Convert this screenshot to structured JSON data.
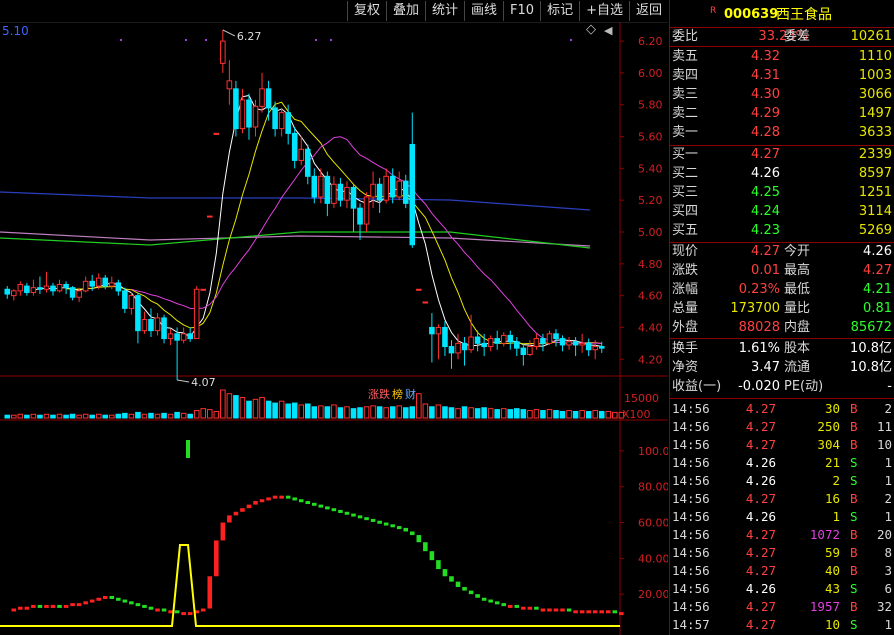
{
  "toolbar": {
    "buttons": [
      "复权",
      "叠加",
      "统计",
      "画线",
      "F10",
      "标记",
      "+自选",
      "返回"
    ]
  },
  "chart": {
    "ma_label": "5.10",
    "high_label": "6.27",
    "low_label": "4.07",
    "price_ticks": [
      "6.20",
      "6.00",
      "5.80",
      "5.60",
      "5.40",
      "5.20",
      "5.00",
      "4.80",
      "4.60",
      "4.40",
      "4.20"
    ],
    "volume_tick": "15000",
    "volume_unit": "X100",
    "ind_ticks": [
      "100.0",
      "80.00",
      "60.00",
      "40.00",
      "20.00"
    ],
    "badges": [
      {
        "text": "涨跌",
        "color": "#ff6060"
      },
      {
        "text": "榜",
        "color": "#ffcc00"
      },
      {
        "text": "财",
        "color": "#66aaff"
      }
    ],
    "diamond": "◇",
    "corner": "◀",
    "colors": {
      "up": "#ff3030",
      "down": "#00e5ff",
      "ma5": "#ffffff",
      "ma10": "#e6e600",
      "ma20": "#e040e0",
      "ma60": "#22cc22",
      "ma120": "#c080c0",
      "ma250": "#2a3fc0",
      "axis": "#8b0000"
    }
  },
  "stock": {
    "badge": "R",
    "code": "000639",
    "name": "西王食品"
  },
  "order_book": {
    "ratio_label": "委比",
    "ratio_value": "33.23%",
    "diff_label": "委差",
    "diff_value": "10261",
    "asks": [
      {
        "label": "卖五",
        "price": "4.32",
        "vol": "1110"
      },
      {
        "label": "卖四",
        "price": "4.31",
        "vol": "1003"
      },
      {
        "label": "卖三",
        "price": "4.30",
        "vol": "3066"
      },
      {
        "label": "卖二",
        "price": "4.29",
        "vol": "1497"
      },
      {
        "label": "卖一",
        "price": "4.28",
        "vol": "3633"
      }
    ],
    "bids": [
      {
        "label": "买一",
        "price": "4.27",
        "vol": "2339",
        "color": "red"
      },
      {
        "label": "买二",
        "price": "4.26",
        "vol": "8597",
        "color": "white"
      },
      {
        "label": "买三",
        "price": "4.25",
        "vol": "1251",
        "color": "green"
      },
      {
        "label": "买四",
        "price": "4.24",
        "vol": "3114",
        "color": "green"
      },
      {
        "label": "买五",
        "price": "4.23",
        "vol": "5269",
        "color": "green"
      }
    ]
  },
  "quote": [
    {
      "l1": "现价",
      "v1": "4.27",
      "c1": "red",
      "l2": "今开",
      "v2": "4.26",
      "c2": "white"
    },
    {
      "l1": "涨跌",
      "v1": "0.01",
      "c1": "red",
      "l2": "最高",
      "v2": "4.27",
      "c2": "red"
    },
    {
      "l1": "涨幅",
      "v1": "0.23%",
      "c1": "red",
      "l2": "最低",
      "v2": "4.21",
      "c2": "green"
    },
    {
      "l1": "总量",
      "v1": "173700",
      "c1": "yellow",
      "l2": "量比",
      "v2": "0.81",
      "c2": "green"
    },
    {
      "l1": "外盘",
      "v1": "88028",
      "c1": "red",
      "l2": "内盘",
      "v2": "85672",
      "c2": "green"
    }
  ],
  "fundamentals": [
    {
      "l1": "换手",
      "v1": "1.61%",
      "l2": "股本",
      "v2": "10.8亿"
    },
    {
      "l1": "净资",
      "v1": "3.47",
      "l2": "流通",
      "v2": "10.8亿"
    },
    {
      "l1": "收益(一)",
      "v1": "-0.020",
      "l2": "PE(动)",
      "v2": "-"
    }
  ],
  "trades": [
    {
      "time": "14:56",
      "price": "4.27",
      "pc": "red",
      "vol": "30",
      "vc": "yellow",
      "side": "B",
      "n": "2"
    },
    {
      "time": "14:56",
      "price": "4.27",
      "pc": "red",
      "vol": "250",
      "vc": "yellow",
      "side": "B",
      "n": "11"
    },
    {
      "time": "14:56",
      "price": "4.27",
      "pc": "red",
      "vol": "304",
      "vc": "yellow",
      "side": "B",
      "n": "10"
    },
    {
      "time": "14:56",
      "price": "4.26",
      "pc": "white",
      "vol": "21",
      "vc": "yellow",
      "side": "S",
      "n": "1"
    },
    {
      "time": "14:56",
      "price": "4.26",
      "pc": "white",
      "vol": "2",
      "vc": "yellow",
      "side": "S",
      "n": "1"
    },
    {
      "time": "14:56",
      "price": "4.27",
      "pc": "red",
      "vol": "16",
      "vc": "yellow",
      "side": "B",
      "n": "2"
    },
    {
      "time": "14:56",
      "price": "4.26",
      "pc": "white",
      "vol": "1",
      "vc": "yellow",
      "side": "S",
      "n": "1"
    },
    {
      "time": "14:56",
      "price": "4.27",
      "pc": "red",
      "vol": "1072",
      "vc": "magenta",
      "side": "B",
      "n": "20"
    },
    {
      "time": "14:56",
      "price": "4.27",
      "pc": "red",
      "vol": "59",
      "vc": "yellow",
      "side": "B",
      "n": "8"
    },
    {
      "time": "14:56",
      "price": "4.27",
      "pc": "red",
      "vol": "40",
      "vc": "yellow",
      "side": "B",
      "n": "3"
    },
    {
      "time": "14:56",
      "price": "4.26",
      "pc": "white",
      "vol": "43",
      "vc": "yellow",
      "side": "S",
      "n": "6"
    },
    {
      "time": "14:56",
      "price": "4.27",
      "pc": "red",
      "vol": "1957",
      "vc": "magenta",
      "side": "B",
      "n": "32"
    },
    {
      "time": "14:57",
      "price": "4.27",
      "pc": "red",
      "vol": "10",
      "vc": "yellow",
      "side": "S",
      "n": "1"
    }
  ],
  "chart_data": {
    "type": "candlestick",
    "price_axis": [
      4.2,
      6.2
    ],
    "candles": [
      {
        "o": 4.64,
        "c": 4.61,
        "h": 4.66,
        "l": 4.58
      },
      {
        "o": 4.6,
        "c": 4.63,
        "h": 4.64,
        "l": 4.57
      },
      {
        "o": 4.63,
        "c": 4.67,
        "h": 4.69,
        "l": 4.6
      },
      {
        "o": 4.66,
        "c": 4.62,
        "h": 4.68,
        "l": 4.6
      },
      {
        "o": 4.62,
        "c": 4.65,
        "h": 4.7,
        "l": 4.6
      },
      {
        "o": 4.65,
        "c": 4.64,
        "h": 4.72,
        "l": 4.61
      },
      {
        "o": 4.64,
        "c": 4.66,
        "h": 4.75,
        "l": 4.62
      },
      {
        "o": 4.66,
        "c": 4.63,
        "h": 4.68,
        "l": 4.6
      },
      {
        "o": 4.63,
        "c": 4.67,
        "h": 4.7,
        "l": 4.62
      },
      {
        "o": 4.67,
        "c": 4.65,
        "h": 4.69,
        "l": 4.61
      },
      {
        "o": 4.65,
        "c": 4.59,
        "h": 4.66,
        "l": 4.57
      },
      {
        "o": 4.59,
        "c": 4.63,
        "h": 4.65,
        "l": 4.56
      },
      {
        "o": 4.63,
        "c": 4.69,
        "h": 4.72,
        "l": 4.62
      },
      {
        "o": 4.69,
        "c": 4.66,
        "h": 4.73,
        "l": 4.63
      },
      {
        "o": 4.66,
        "c": 4.71,
        "h": 4.74,
        "l": 4.64
      },
      {
        "o": 4.71,
        "c": 4.66,
        "h": 4.73,
        "l": 4.64
      },
      {
        "o": 4.66,
        "c": 4.68,
        "h": 4.72,
        "l": 4.64
      },
      {
        "o": 4.68,
        "c": 4.63,
        "h": 4.7,
        "l": 4.6
      },
      {
        "o": 4.63,
        "c": 4.52,
        "h": 4.65,
        "l": 4.49
      },
      {
        "o": 4.52,
        "c": 4.6,
        "h": 4.62,
        "l": 4.48
      },
      {
        "o": 4.6,
        "c": 4.38,
        "h": 4.62,
        "l": 4.3
      },
      {
        "o": 4.38,
        "c": 4.45,
        "h": 4.5,
        "l": 4.36
      },
      {
        "o": 4.45,
        "c": 4.38,
        "h": 4.52,
        "l": 4.34
      },
      {
        "o": 4.38,
        "c": 4.46,
        "h": 4.49,
        "l": 4.35
      },
      {
        "o": 4.46,
        "c": 4.33,
        "h": 4.48,
        "l": 4.3
      },
      {
        "o": 4.33,
        "c": 4.36,
        "h": 4.39,
        "l": 4.29
      },
      {
        "o": 4.36,
        "c": 4.32,
        "h": 4.4,
        "l": 4.07
      },
      {
        "o": 4.32,
        "c": 4.36,
        "h": 4.4,
        "l": 4.3
      },
      {
        "o": 4.36,
        "c": 4.33,
        "h": 4.4,
        "l": 4.31
      },
      {
        "o": 4.33,
        "c": 4.64,
        "h": 4.66,
        "l": 4.33
      },
      {
        "o": 4.64,
        "c": 4.64,
        "h": 4.64,
        "l": 4.64
      },
      {
        "o": 5.1,
        "c": 5.1,
        "h": 5.1,
        "l": 5.1
      },
      {
        "o": 5.62,
        "c": 5.62,
        "h": 5.62,
        "l": 5.62
      },
      {
        "o": 6.06,
        "c": 6.2,
        "h": 6.27,
        "l": 6.0
      },
      {
        "o": 5.9,
        "c": 5.95,
        "h": 6.08,
        "l": 5.8
      },
      {
        "o": 5.9,
        "c": 5.65,
        "h": 5.95,
        "l": 5.6
      },
      {
        "o": 5.65,
        "c": 5.83,
        "h": 5.9,
        "l": 5.62
      },
      {
        "o": 5.83,
        "c": 5.66,
        "h": 5.87,
        "l": 5.58
      },
      {
        "o": 5.66,
        "c": 5.79,
        "h": 5.83,
        "l": 5.6
      },
      {
        "o": 5.79,
        "c": 5.9,
        "h": 6.0,
        "l": 5.75
      },
      {
        "o": 5.9,
        "c": 5.78,
        "h": 5.95,
        "l": 5.7
      },
      {
        "o": 5.78,
        "c": 5.65,
        "h": 5.82,
        "l": 5.6
      },
      {
        "o": 5.65,
        "c": 5.75,
        "h": 5.78,
        "l": 5.6
      },
      {
        "o": 5.75,
        "c": 5.62,
        "h": 5.8,
        "l": 5.55
      },
      {
        "o": 5.62,
        "c": 5.45,
        "h": 5.66,
        "l": 5.4
      },
      {
        "o": 5.45,
        "c": 5.52,
        "h": 5.6,
        "l": 5.42
      },
      {
        "o": 5.52,
        "c": 5.35,
        "h": 5.55,
        "l": 5.3
      },
      {
        "o": 5.35,
        "c": 5.22,
        "h": 5.4,
        "l": 5.18
      },
      {
        "o": 5.22,
        "c": 5.35,
        "h": 5.4,
        "l": 5.18
      },
      {
        "o": 5.35,
        "c": 5.18,
        "h": 5.38,
        "l": 5.1
      },
      {
        "o": 5.18,
        "c": 5.3,
        "h": 5.35,
        "l": 5.15
      },
      {
        "o": 5.3,
        "c": 5.2,
        "h": 5.34,
        "l": 5.16
      },
      {
        "o": 5.2,
        "c": 5.28,
        "h": 5.32,
        "l": 5.15
      },
      {
        "o": 5.28,
        "c": 5.15,
        "h": 5.3,
        "l": 5.0
      },
      {
        "o": 5.15,
        "c": 5.05,
        "h": 5.18,
        "l": 4.95
      },
      {
        "o": 5.05,
        "c": 5.22,
        "h": 5.25,
        "l": 5.0
      },
      {
        "o": 5.22,
        "c": 5.3,
        "h": 5.38,
        "l": 5.15
      },
      {
        "o": 5.3,
        "c": 5.2,
        "h": 5.34,
        "l": 5.12
      },
      {
        "o": 5.2,
        "c": 5.35,
        "h": 5.4,
        "l": 5.18
      },
      {
        "o": 5.35,
        "c": 5.22,
        "h": 5.4,
        "l": 5.18
      },
      {
        "o": 5.22,
        "c": 5.32,
        "h": 5.38,
        "l": 5.2
      },
      {
        "o": 5.32,
        "c": 5.18,
        "h": 5.36,
        "l": 5.15
      },
      {
        "o": 5.55,
        "c": 4.92,
        "h": 5.75,
        "l": 4.9
      },
      {
        "o": 4.64,
        "c": 4.64,
        "h": 4.64,
        "l": 4.64
      },
      {
        "o": 4.56,
        "c": 4.56,
        "h": 4.56,
        "l": 4.56
      },
      {
        "o": 4.4,
        "c": 4.36,
        "h": 4.49,
        "l": 4.18
      },
      {
        "o": 4.36,
        "c": 4.4,
        "h": 4.42,
        "l": 4.2
      },
      {
        "o": 4.4,
        "c": 4.28,
        "h": 4.44,
        "l": 4.22
      },
      {
        "o": 4.28,
        "c": 4.24,
        "h": 4.32,
        "l": 4.14
      },
      {
        "o": 4.24,
        "c": 4.3,
        "h": 4.36,
        "l": 4.2
      },
      {
        "o": 4.3,
        "c": 4.26,
        "h": 4.34,
        "l": 4.16
      },
      {
        "o": 4.26,
        "c": 4.34,
        "h": 4.48,
        "l": 4.24
      },
      {
        "o": 4.34,
        "c": 4.3,
        "h": 4.38,
        "l": 4.25
      },
      {
        "o": 4.3,
        "c": 4.28,
        "h": 4.36,
        "l": 4.22
      },
      {
        "o": 4.28,
        "c": 4.33,
        "h": 4.35,
        "l": 4.25
      },
      {
        "o": 4.33,
        "c": 4.3,
        "h": 4.38,
        "l": 4.26
      },
      {
        "o": 4.3,
        "c": 4.35,
        "h": 4.37,
        "l": 4.28
      },
      {
        "o": 4.35,
        "c": 4.31,
        "h": 4.38,
        "l": 4.26
      },
      {
        "o": 4.31,
        "c": 4.27,
        "h": 4.34,
        "l": 4.22
      },
      {
        "o": 4.27,
        "c": 4.23,
        "h": 4.3,
        "l": 4.16
      },
      {
        "o": 4.23,
        "c": 4.28,
        "h": 4.32,
        "l": 4.22
      },
      {
        "o": 4.28,
        "c": 4.33,
        "h": 4.36,
        "l": 4.26
      },
      {
        "o": 4.33,
        "c": 4.3,
        "h": 4.36,
        "l": 4.25
      },
      {
        "o": 4.3,
        "c": 4.36,
        "h": 4.38,
        "l": 4.29
      },
      {
        "o": 4.36,
        "c": 4.33,
        "h": 4.39,
        "l": 4.28
      },
      {
        "o": 4.33,
        "c": 4.29,
        "h": 4.35,
        "l": 4.25
      },
      {
        "o": 4.29,
        "c": 4.31,
        "h": 4.34,
        "l": 4.26
      },
      {
        "o": 4.31,
        "c": 4.29,
        "h": 4.34,
        "l": 4.22
      },
      {
        "o": 4.29,
        "c": 4.3,
        "h": 4.36,
        "l": 4.24
      },
      {
        "o": 4.3,
        "c": 4.26,
        "h": 4.33,
        "l": 4.22
      },
      {
        "o": 4.26,
        "c": 4.28,
        "h": 4.32,
        "l": 4.2
      },
      {
        "o": 4.28,
        "c": 4.27,
        "h": 4.31,
        "l": 4.24
      }
    ],
    "volume": [
      3,
      3,
      4,
      3,
      4,
      3,
      4,
      3,
      4,
      3,
      4,
      3,
      4,
      3,
      4,
      3,
      3,
      4,
      5,
      4,
      6,
      4,
      5,
      4,
      5,
      4,
      6,
      5,
      4,
      8,
      10,
      9,
      7,
      30,
      26,
      24,
      22,
      18,
      20,
      22,
      18,
      16,
      18,
      15,
      16,
      14,
      15,
      12,
      13,
      12,
      14,
      11,
      12,
      10,
      11,
      12,
      13,
      12,
      11,
      12,
      13,
      11,
      12,
      26,
      15,
      12,
      14,
      12,
      11,
      10,
      12,
      11,
      10,
      11,
      10,
      9,
      10,
      9,
      10,
      9,
      8,
      9,
      8,
      9,
      8,
      7,
      8,
      7,
      8,
      7,
      8,
      7,
      7,
      6,
      6
    ],
    "indicator": [
      12,
      12,
      13,
      13,
      14,
      13,
      14,
      14,
      13,
      14,
      15,
      15,
      16,
      17,
      18,
      19,
      18,
      17,
      16,
      15,
      14,
      13,
      12,
      12,
      11,
      11,
      10,
      10,
      10,
      11,
      12,
      30,
      50,
      60,
      64,
      66,
      68,
      70,
      72,
      73,
      74,
      75,
      75,
      74,
      73,
      72,
      71,
      70,
      69,
      68,
      67,
      66,
      65,
      64,
      63,
      62,
      61,
      60,
      59,
      58,
      57,
      55,
      53,
      49,
      44,
      39,
      34,
      30,
      27,
      24,
      22,
      20,
      18,
      17,
      16,
      15,
      14,
      14,
      13,
      13,
      13,
      12,
      12,
      12,
      12,
      12,
      11,
      11,
      11,
      11,
      11,
      11,
      11,
      10,
      10
    ]
  }
}
